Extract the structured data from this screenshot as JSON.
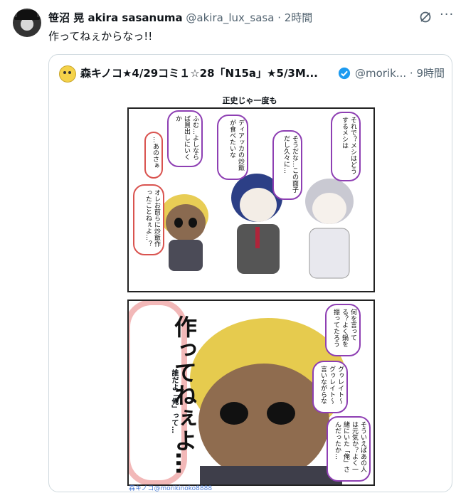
{
  "tweet": {
    "author_name": "笹沼 晃 akira sasanuma",
    "handle": "@akira_lux_sasa",
    "dot": "·",
    "time": "2時間",
    "text": "作ってねぇからなっ!!"
  },
  "quote": {
    "author_name": "森キノコ★4/29コミ１☆28「N15a」★5/3M...",
    "handle": "@morik...",
    "dot": "·",
    "time": "9時間",
    "manga": {
      "title": "正史じゃ一度も",
      "panel1_bubbles": [
        "それで？メシはどうするメシは",
        "そうだな…この面子だし久々に…",
        "ディアッカの炒飯が食べたいな",
        "ふむ…よしならば買出しにいくか",
        "…あのさぁ",
        "オレお前らに炒飯作ったことねぇよ…？"
      ],
      "panel2_shout": "作ってねぇよ…",
      "panel2_sub": "誰だよ「俺」って…",
      "panel2_bubbles": [
        "何を言ってる？よく鍋を振ってたろう",
        "グゥレイト～グゥレイト～言いながらな",
        "そういえばあの人は元気か？よく一緒にいた「俺」さんだったか…"
      ],
      "credit": "森キノコ@morikinoko8888"
    }
  },
  "colors": {
    "accent": "#1d9bf0",
    "bubble_border": "#8e3fb3",
    "muted": "#536471"
  }
}
